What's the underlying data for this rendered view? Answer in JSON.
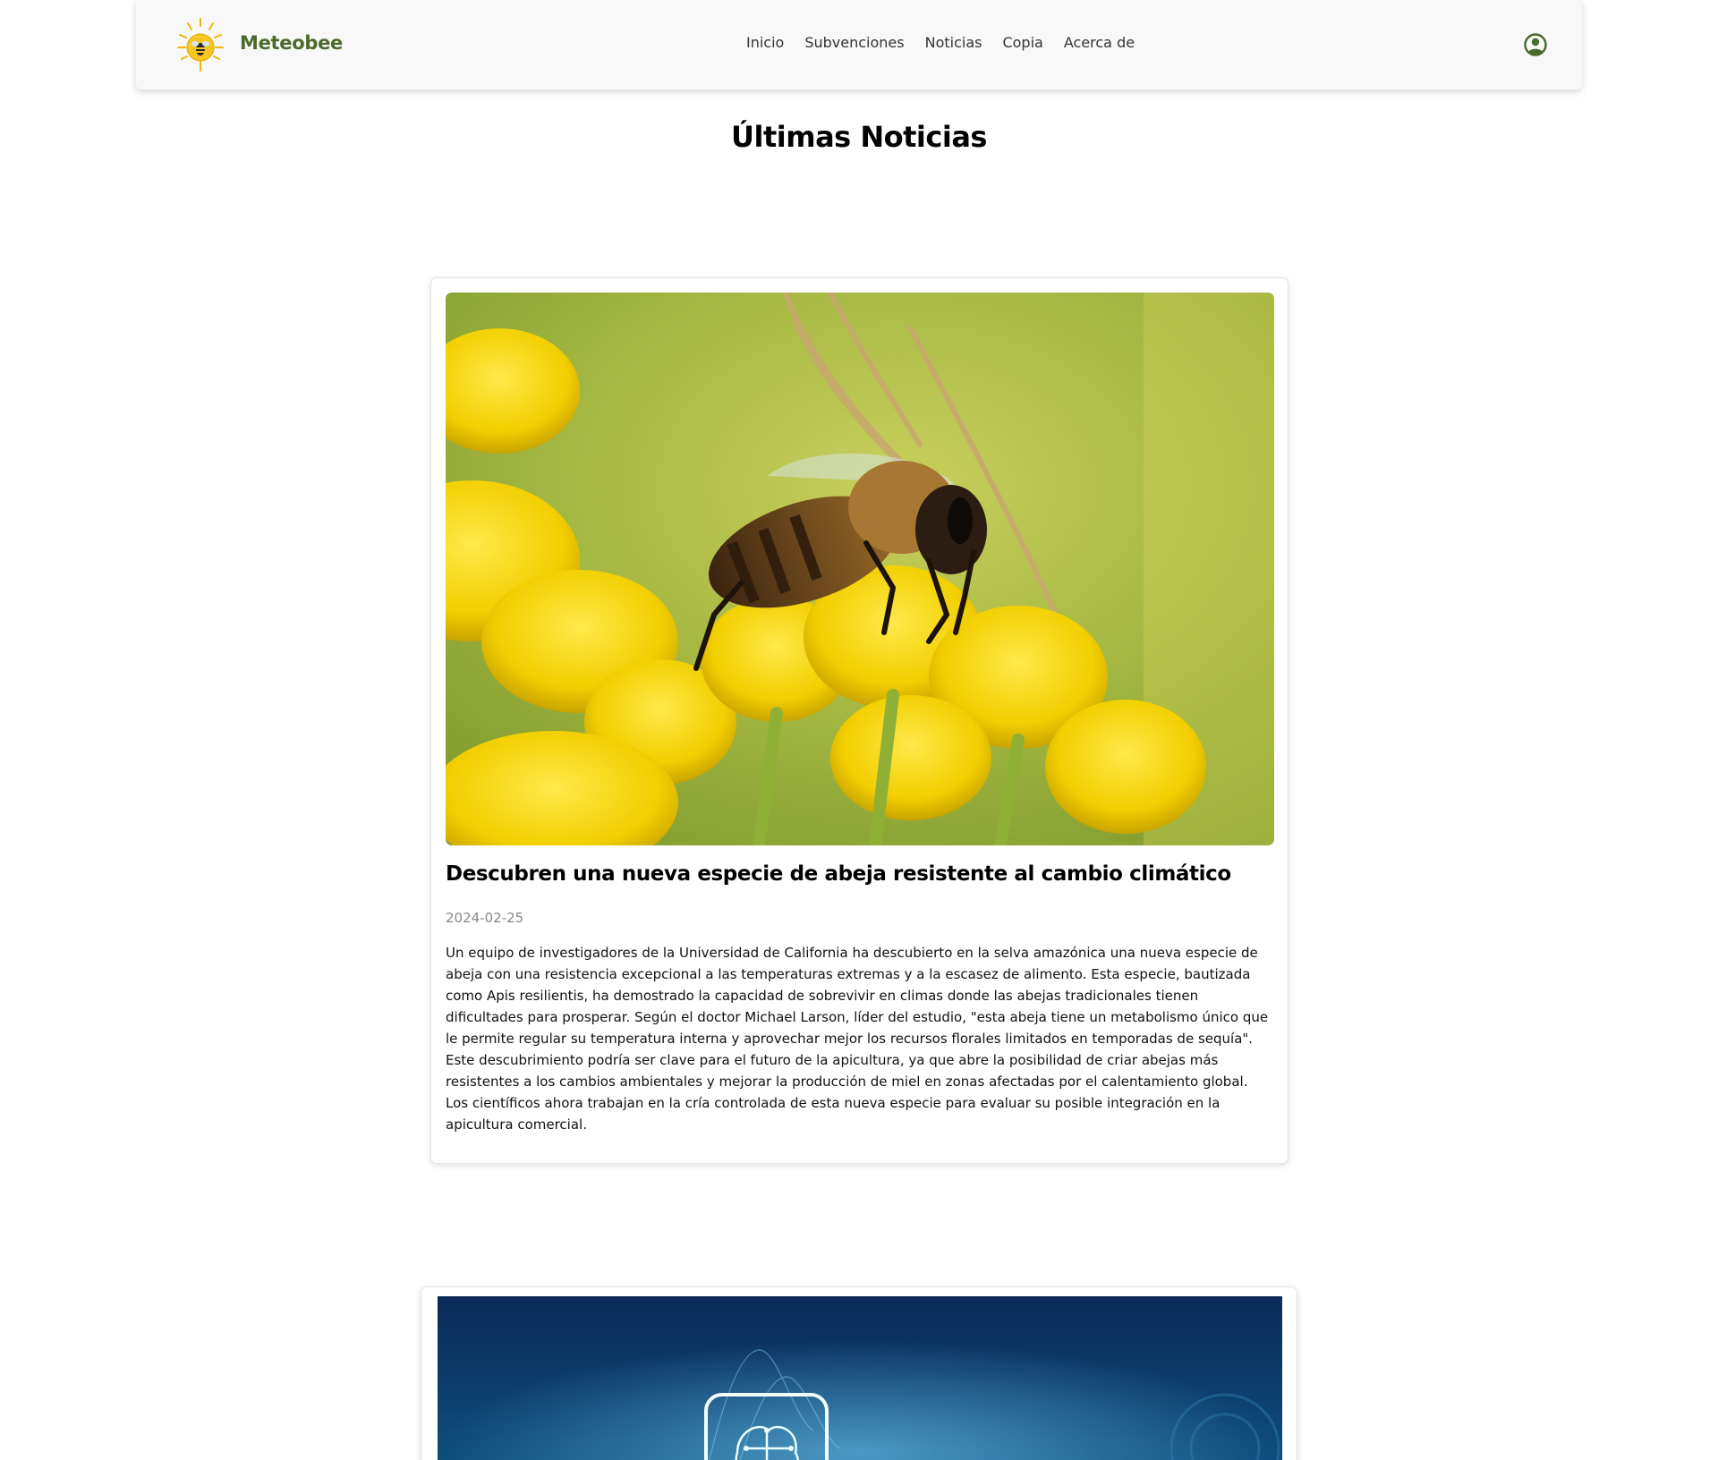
{
  "header": {
    "brand": "Meteobee",
    "nav": [
      "Inicio",
      "Subvenciones",
      "Noticias",
      "Copia",
      "Acerca de"
    ],
    "accent": "#4a6b2b"
  },
  "page": {
    "title": "Últimas Noticias"
  },
  "news": [
    {
      "title": "Descubren una nueva especie de abeja resistente al cambio climático",
      "date": "2024-02-25",
      "body": "Un equipo de investigadores de la Universidad de California ha descubierto en la selva amazónica una nueva especie de abeja con una resistencia excepcional a las temperaturas extremas y a la escasez de alimento. Esta especie, bautizada como Apis resilientis, ha demostrado la capacidad de sobrevivir en climas donde las abejas tradicionales tienen dificultades para prosperar. Según el doctor Michael Larson, líder del estudio, \"esta abeja tiene un metabolismo único que le permite regular su temperatura interna y aprovechar mejor los recursos florales limitados en temporadas de sequía\". Este descubrimiento podría ser clave para el futuro de la apicultura, ya que abre la posibilidad de criar abejas más resistentes a los cambios ambientales y mejorar la producción de miel en zonas afectadas por el calentamiento global. Los científicos ahora trabajan en la cría controlada de esta nueva especie para evaluar su posible integración en la apicultura comercial.",
      "image_icon": "bee-on-flower-photo"
    },
    {
      "image_icon": "ai-brain-circuit-photo"
    }
  ]
}
